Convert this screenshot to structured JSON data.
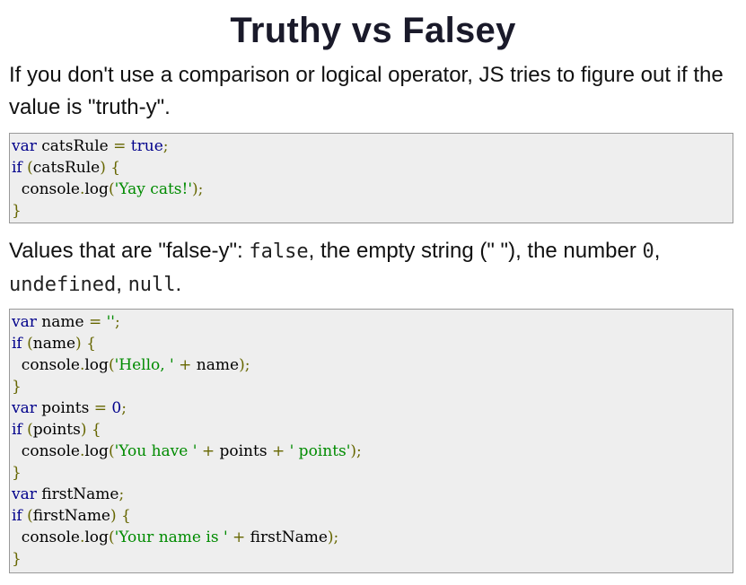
{
  "slide": {
    "title": "Truthy vs Falsey",
    "intro_text": "If you don't use a comparison or logical operator, JS tries to figure out if the value is \"truth-y\".",
    "falsey_prefix": "Values that are \"false-y\": ",
    "falsey_false": "false",
    "falsey_mid": ", the empty string (\" \"), the number ",
    "falsey_zero": "0",
    "falsey_sep1": ", ",
    "falsey_undefined": "undefined",
    "falsey_sep2": ", ",
    "falsey_null": "null",
    "falsey_end": "."
  },
  "code1": [
    [
      [
        "kw",
        "var"
      ],
      [
        "id",
        " catsRule "
      ],
      [
        "br",
        "="
      ],
      [
        "id",
        " "
      ],
      [
        "kw",
        "true"
      ],
      [
        "br",
        ";"
      ]
    ],
    [
      [
        "kw",
        "if"
      ],
      [
        "id",
        " "
      ],
      [
        "br",
        "("
      ],
      [
        "id",
        "catsRule"
      ],
      [
        "br",
        ")"
      ],
      [
        "id",
        " "
      ],
      [
        "br",
        "{"
      ]
    ],
    [
      [
        "id",
        "  console"
      ],
      [
        "br",
        "."
      ],
      [
        "id",
        "log"
      ],
      [
        "br",
        "("
      ],
      [
        "str",
        "'Yay cats!'"
      ],
      [
        "br",
        ");"
      ]
    ],
    [
      [
        "br",
        "}"
      ]
    ]
  ],
  "code2": [
    [
      [
        "kw",
        "var"
      ],
      [
        "id",
        " name "
      ],
      [
        "br",
        "="
      ],
      [
        "id",
        " "
      ],
      [
        "str",
        "''"
      ],
      [
        "br",
        ";"
      ]
    ],
    [
      [
        "kw",
        "if"
      ],
      [
        "id",
        " "
      ],
      [
        "br",
        "("
      ],
      [
        "id",
        "name"
      ],
      [
        "br",
        ")"
      ],
      [
        "id",
        " "
      ],
      [
        "br",
        "{"
      ]
    ],
    [
      [
        "id",
        "  console"
      ],
      [
        "br",
        "."
      ],
      [
        "id",
        "log"
      ],
      [
        "br",
        "("
      ],
      [
        "str",
        "'Hello, '"
      ],
      [
        "id",
        " "
      ],
      [
        "br",
        "+"
      ],
      [
        "id",
        " name"
      ],
      [
        "br",
        ");"
      ]
    ],
    [
      [
        "br",
        "}"
      ]
    ],
    [
      [
        "kw",
        "var"
      ],
      [
        "id",
        " points "
      ],
      [
        "br",
        "="
      ],
      [
        "id",
        " "
      ],
      [
        "num",
        "0"
      ],
      [
        "br",
        ";"
      ]
    ],
    [
      [
        "kw",
        "if"
      ],
      [
        "id",
        " "
      ],
      [
        "br",
        "("
      ],
      [
        "id",
        "points"
      ],
      [
        "br",
        ")"
      ],
      [
        "id",
        " "
      ],
      [
        "br",
        "{"
      ]
    ],
    [
      [
        "id",
        "  console"
      ],
      [
        "br",
        "."
      ],
      [
        "id",
        "log"
      ],
      [
        "br",
        "("
      ],
      [
        "str",
        "'You have '"
      ],
      [
        "id",
        " "
      ],
      [
        "br",
        "+"
      ],
      [
        "id",
        " points "
      ],
      [
        "br",
        "+"
      ],
      [
        "id",
        " "
      ],
      [
        "str",
        "' points'"
      ],
      [
        "br",
        ");"
      ]
    ],
    [
      [
        "br",
        "}"
      ]
    ],
    [
      [
        "kw",
        "var"
      ],
      [
        "id",
        " firstName"
      ],
      [
        "br",
        ";"
      ]
    ],
    [
      [
        "kw",
        "if"
      ],
      [
        "id",
        " "
      ],
      [
        "br",
        "("
      ],
      [
        "id",
        "firstName"
      ],
      [
        "br",
        ")"
      ],
      [
        "id",
        " "
      ],
      [
        "br",
        "{"
      ]
    ],
    [
      [
        "id",
        "  console"
      ],
      [
        "br",
        "."
      ],
      [
        "id",
        "log"
      ],
      [
        "br",
        "("
      ],
      [
        "str",
        "'Your name is '"
      ],
      [
        "id",
        " "
      ],
      [
        "br",
        "+"
      ],
      [
        "id",
        " firstName"
      ],
      [
        "br",
        ");"
      ]
    ],
    [
      [
        "br",
        "}"
      ]
    ]
  ]
}
